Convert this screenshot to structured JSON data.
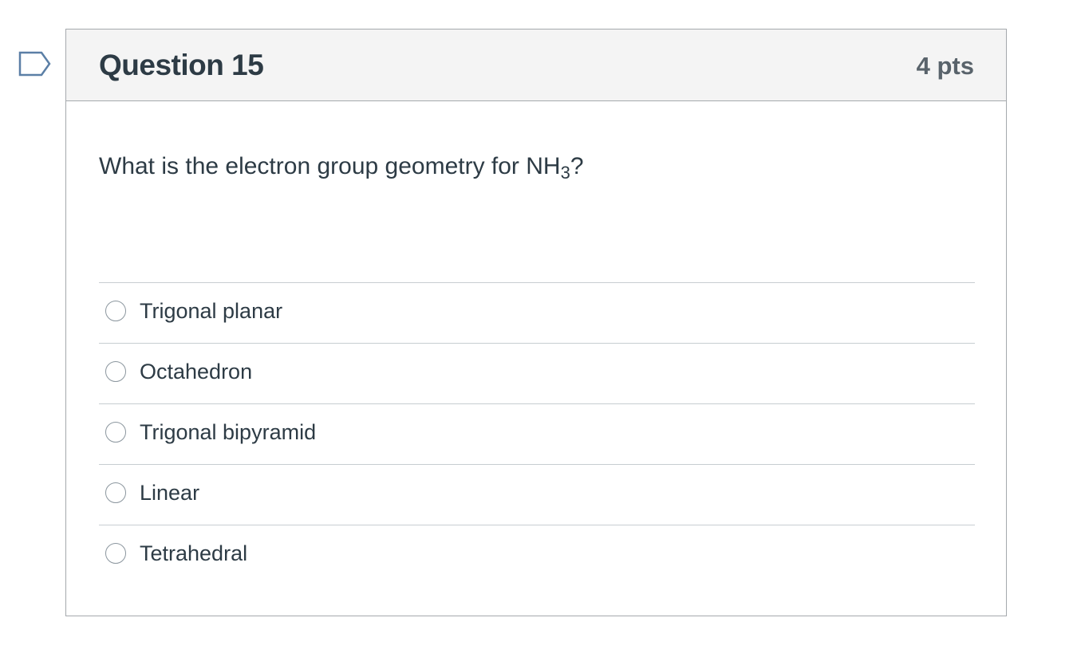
{
  "question": {
    "title": "Question 15",
    "points": "4 pts",
    "text_main": "What is the electron group geometry for NH",
    "text_subscript": "3",
    "text_suffix": "?"
  },
  "answers": [
    {
      "label": "Trigonal planar",
      "selected": false
    },
    {
      "label": "Octahedron",
      "selected": false
    },
    {
      "label": "Trigonal bipyramid",
      "selected": false
    },
    {
      "label": "Linear",
      "selected": false
    },
    {
      "label": "Tetrahedral",
      "selected": false
    }
  ],
  "colors": {
    "flag_stroke": "#5b7fa6",
    "header_bg": "#f4f4f4",
    "border": "#a5a9ad",
    "text": "#2d3b45",
    "points_text": "#59636b"
  },
  "icons": {
    "flag": "flag-question-icon"
  }
}
